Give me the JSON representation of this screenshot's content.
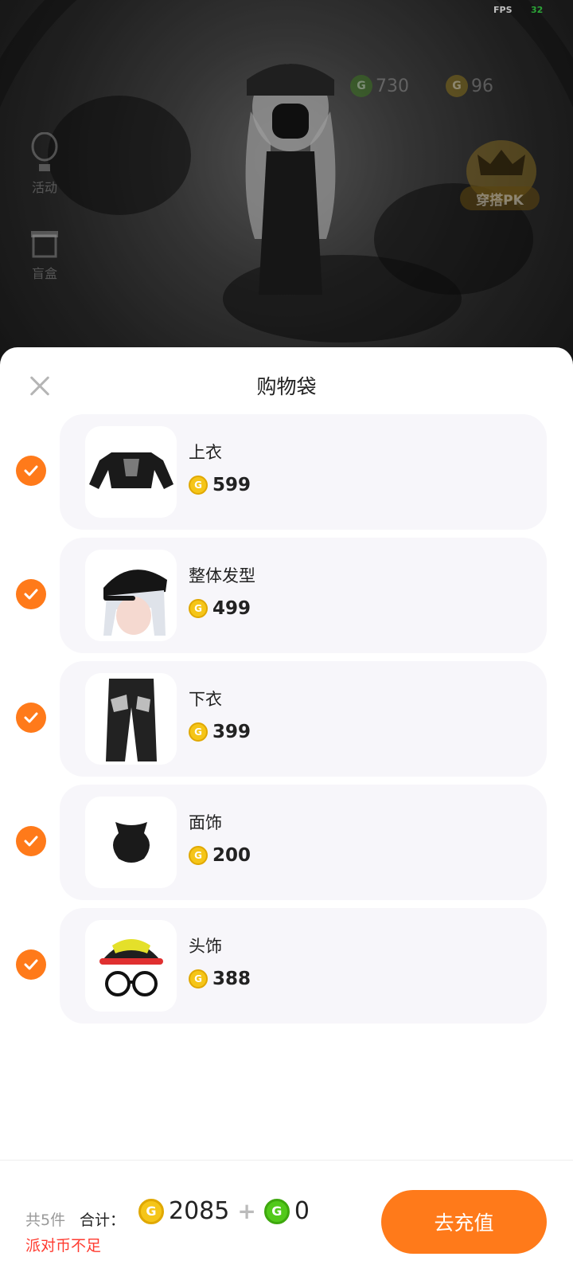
{
  "hud": {
    "fps_label": "FPS",
    "fps_value": "32",
    "currency_green": "730",
    "currency_gold": "96",
    "side_label_1": "活动",
    "side_label_2": "盲盒",
    "pk_label": "穿搭PK"
  },
  "sheet": {
    "title": "购物袋"
  },
  "items": [
    {
      "name": "上衣",
      "price": "599"
    },
    {
      "name": "整体发型",
      "price": "499"
    },
    {
      "name": "下衣",
      "price": "399"
    },
    {
      "name": "面饰",
      "price": "200"
    },
    {
      "name": "头饰",
      "price": "388"
    }
  ],
  "footer": {
    "count": "共5件",
    "total_label": "合计：",
    "total_gold": "2085",
    "plus": "+",
    "total_green": "0",
    "warning": "派对币不足",
    "recharge_label": "去充值"
  },
  "colors": {
    "accent": "#ff7a1a",
    "warning": "#ff3b30",
    "coin_gold": "#f5c518",
    "coin_green": "#52c91a"
  }
}
